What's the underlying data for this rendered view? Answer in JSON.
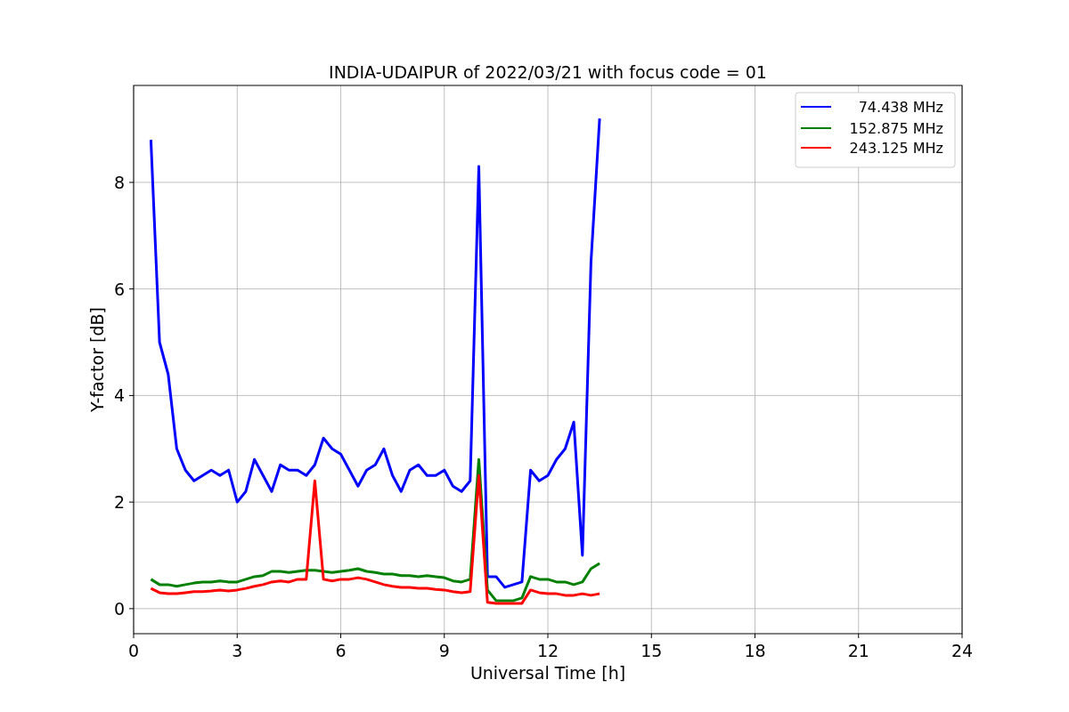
{
  "plot": {
    "chart_data": {
      "type": "line",
      "title": "INDIA-UDAIPUR of 2022/03/21 with focus code = 01",
      "xlabel": "Universal Time [h]",
      "ylabel": "Y-factor [dB]",
      "xlim": [
        0,
        24
      ],
      "ylim": [
        -0.47,
        9.82
      ],
      "xticks": [
        0,
        3,
        6,
        9,
        12,
        15,
        18,
        21,
        24
      ],
      "yticks": [
        0,
        2,
        4,
        6,
        8
      ],
      "grid": true,
      "legend": true,
      "x": [
        0.5,
        0.75,
        1.0,
        1.25,
        1.5,
        1.75,
        2.0,
        2.25,
        2.5,
        2.75,
        3.0,
        3.25,
        3.5,
        3.75,
        4.0,
        4.25,
        4.5,
        4.75,
        5.0,
        5.25,
        5.5,
        5.75,
        6.0,
        6.25,
        6.5,
        6.75,
        7.0,
        7.25,
        7.5,
        7.75,
        8.0,
        8.25,
        8.5,
        8.75,
        9.0,
        9.25,
        9.5,
        9.75,
        10.0,
        10.25,
        10.5,
        10.75,
        11.0,
        11.25,
        11.5,
        11.75,
        12.0,
        12.25,
        12.5,
        12.75,
        13.0,
        13.25,
        13.5
      ],
      "series": [
        {
          "name": "74.438 MHz",
          "color": "#0000ff",
          "values": [
            8.8,
            5.0,
            4.4,
            3.0,
            2.6,
            2.4,
            2.5,
            2.6,
            2.5,
            2.6,
            2.0,
            2.2,
            2.8,
            2.5,
            2.2,
            2.7,
            2.6,
            2.6,
            2.5,
            2.7,
            3.2,
            3.0,
            2.9,
            2.6,
            2.3,
            2.6,
            2.7,
            3.0,
            2.5,
            2.2,
            2.6,
            2.7,
            2.5,
            2.5,
            2.6,
            2.3,
            2.2,
            2.4,
            8.3,
            0.6,
            0.6,
            0.4,
            0.45,
            0.5,
            2.6,
            2.4,
            2.5,
            2.8,
            3.0,
            3.5,
            1.0,
            6.5,
            9.2
          ]
        },
        {
          "name": "152.875 MHz",
          "color": "#008000",
          "values": [
            0.55,
            0.45,
            0.45,
            0.42,
            0.45,
            0.48,
            0.5,
            0.5,
            0.52,
            0.5,
            0.5,
            0.55,
            0.6,
            0.62,
            0.7,
            0.7,
            0.68,
            0.7,
            0.72,
            0.72,
            0.7,
            0.68,
            0.7,
            0.72,
            0.75,
            0.7,
            0.68,
            0.65,
            0.65,
            0.62,
            0.62,
            0.6,
            0.62,
            0.6,
            0.58,
            0.52,
            0.5,
            0.55,
            2.8,
            0.35,
            0.15,
            0.15,
            0.15,
            0.2,
            0.6,
            0.55,
            0.55,
            0.5,
            0.5,
            0.45,
            0.5,
            0.75,
            0.85
          ]
        },
        {
          "name": "243.125 MHz",
          "color": "#ff0000",
          "values": [
            0.38,
            0.3,
            0.28,
            0.28,
            0.3,
            0.32,
            0.32,
            0.33,
            0.35,
            0.33,
            0.35,
            0.38,
            0.42,
            0.45,
            0.5,
            0.52,
            0.5,
            0.55,
            0.55,
            2.4,
            0.55,
            0.52,
            0.55,
            0.55,
            0.58,
            0.55,
            0.5,
            0.45,
            0.42,
            0.4,
            0.4,
            0.38,
            0.38,
            0.36,
            0.35,
            0.32,
            0.3,
            0.32,
            2.5,
            0.12,
            0.1,
            0.1,
            0.1,
            0.1,
            0.35,
            0.3,
            0.28,
            0.28,
            0.25,
            0.25,
            0.28,
            0.25,
            0.28
          ]
        }
      ]
    }
  }
}
